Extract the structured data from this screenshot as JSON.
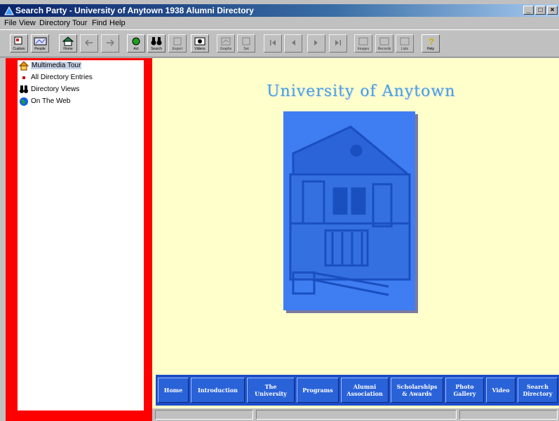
{
  "window": {
    "title": "Search Party - University of Anytown 1938 Alumni Directory"
  },
  "menu": [
    "File",
    "View",
    "Directory",
    "Tour",
    "Find",
    "Help"
  ],
  "toolbar": {
    "buttons": [
      {
        "label": "Custom",
        "icon": "custom-icon"
      },
      {
        "label": "People",
        "icon": "people-icon"
      },
      {
        "label": "Home",
        "icon": "home-icon"
      },
      {
        "label": "",
        "icon": "back-arrow-icon"
      },
      {
        "label": "",
        "icon": "forward-arrow-icon"
      },
      {
        "label": "Act",
        "icon": "act-icon"
      },
      {
        "label": "Search",
        "icon": "search-binoculars-icon"
      },
      {
        "label": "Export",
        "icon": "export-icon"
      },
      {
        "label": "Videos",
        "icon": "videos-icon"
      },
      {
        "label": "Graphs",
        "icon": "graphs-icon"
      },
      {
        "label": "Set",
        "icon": "set-icon"
      },
      {
        "label": "",
        "icon": "first-record-icon"
      },
      {
        "label": "",
        "icon": "previous-record-icon"
      },
      {
        "label": "",
        "icon": "next-record-icon"
      },
      {
        "label": "",
        "icon": "last-record-icon"
      },
      {
        "label": "Images",
        "icon": "images-icon"
      },
      {
        "label": "Records",
        "icon": "records-icon"
      },
      {
        "label": "Lists",
        "icon": "lists-icon"
      },
      {
        "label": "Help",
        "icon": "help-icon"
      }
    ]
  },
  "tree": {
    "items": [
      {
        "label": "Multimedia Tour",
        "icon": "house-icon",
        "selected": true
      },
      {
        "label": "All Directory Entries",
        "icon": "bullet-icon"
      },
      {
        "label": "Directory Views",
        "icon": "binoculars-icon"
      },
      {
        "label": "On The Web",
        "icon": "globe-icon"
      }
    ]
  },
  "content": {
    "title": "University of Anytown",
    "poster_icon": "university-building-image"
  },
  "nav": {
    "buttons": [
      {
        "label": "Home"
      },
      {
        "label": "Introduction"
      },
      {
        "label": "The\nUniversity"
      },
      {
        "label": "Programs"
      },
      {
        "label": "Alumni\nAssociation"
      },
      {
        "label": "Scholarships\n& Awards"
      },
      {
        "label": "Photo\nGallery"
      },
      {
        "label": "Video"
      },
      {
        "label": "Search\nDirectory"
      }
    ]
  },
  "colors": {
    "tree_border": "#ff0000",
    "content_bg": "#ffffcc",
    "nav_bg": "#1e4ec8",
    "poster_blue": "#3f7df2",
    "title_blue": "#4aa0e0"
  }
}
